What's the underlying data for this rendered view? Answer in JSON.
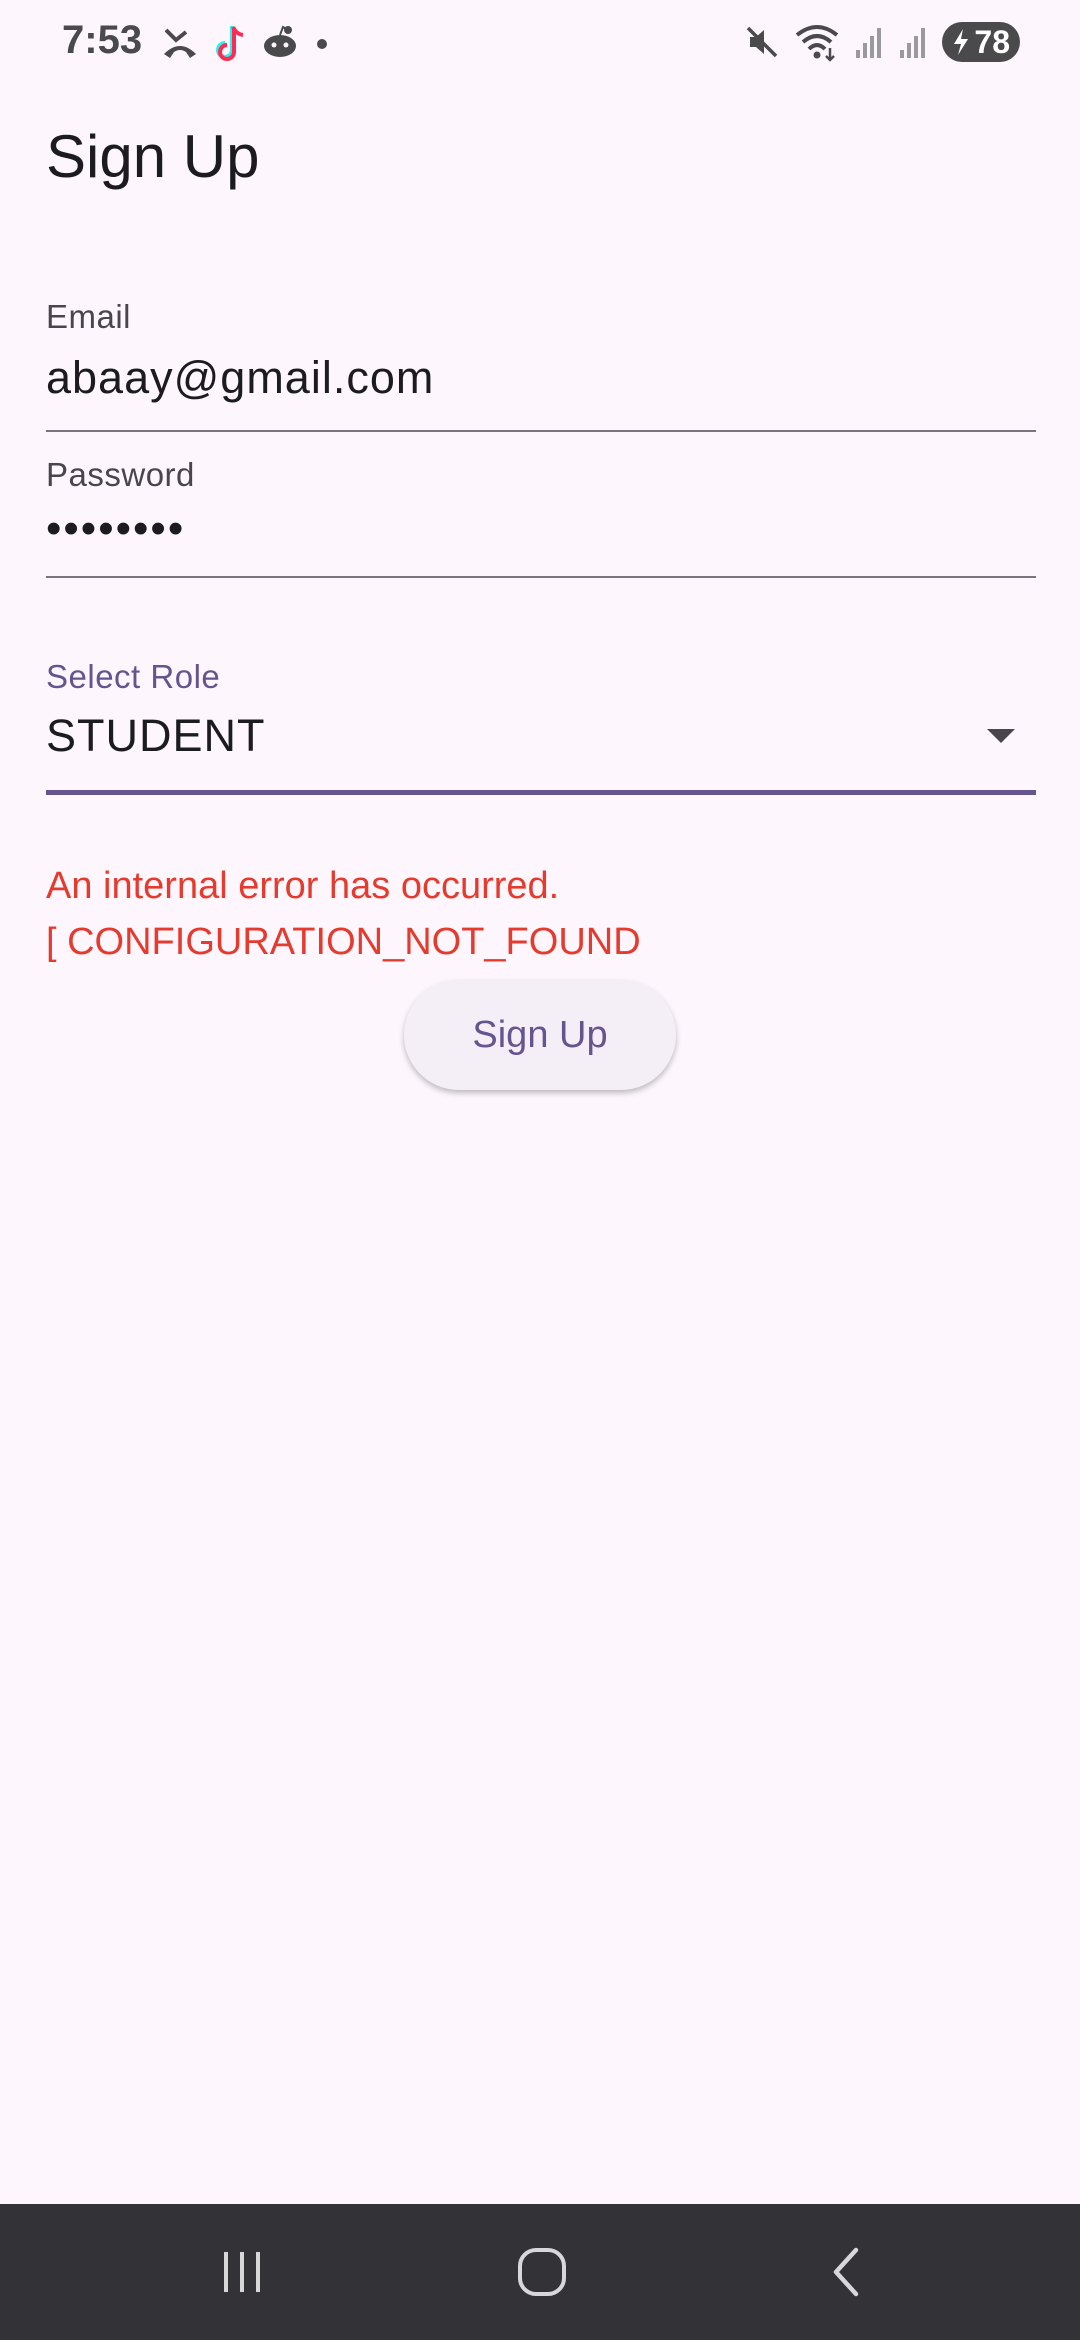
{
  "status_bar": {
    "time": "7:53",
    "left_icons": [
      "missed-call-icon",
      "tiktok-icon",
      "reddit-icon",
      "notification-dot-icon"
    ],
    "right_icons": [
      "mute-icon",
      "wifi-icon",
      "signal-icon",
      "signal-icon-2"
    ],
    "battery_level": "78"
  },
  "page": {
    "title": "Sign Up"
  },
  "form": {
    "email": {
      "label": "Email",
      "value": "abaay@gmail.com"
    },
    "password": {
      "label": "Password",
      "value": "••••••••"
    },
    "role": {
      "label": "Select Role",
      "value": "STUDENT"
    },
    "error_message": "An internal error has occurred.\n[ CONFIGURATION_NOT_FOUND",
    "submit_label": "Sign Up"
  },
  "colors": {
    "background": "#fdf7fd",
    "accent": "#65558f",
    "error": "#e53b2f",
    "nav_bar": "#333236"
  },
  "nav_bar": {
    "buttons": [
      "recents-icon",
      "home-icon",
      "back-icon"
    ]
  }
}
